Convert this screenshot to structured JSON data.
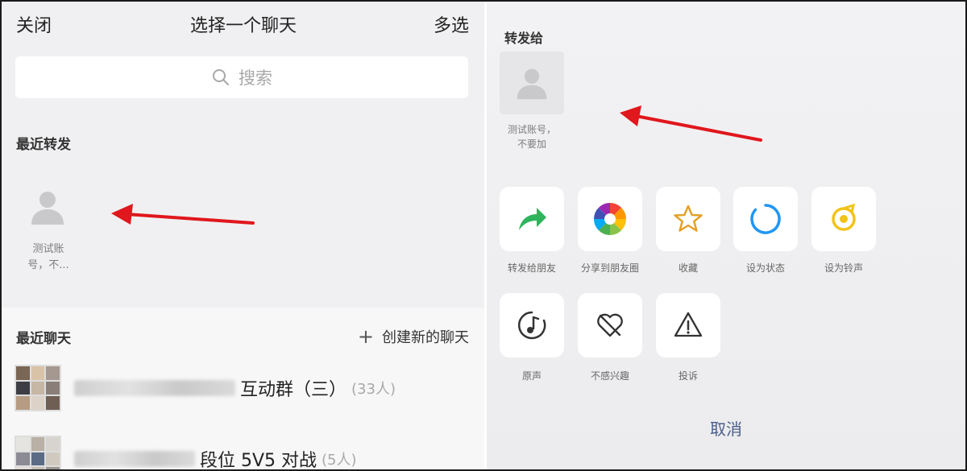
{
  "left": {
    "nav": {
      "close": "关闭",
      "title": "选择一个聊天",
      "multi_select": "多选"
    },
    "search": {
      "placeholder": "搜索"
    },
    "recent_forward": {
      "label": "最近转发",
      "contact": {
        "name_line1": "测试账",
        "name_line2": "号，不..."
      }
    },
    "recent_chats": {
      "label": "最近聊天",
      "create_new": "创建新的聊天",
      "items": [
        {
          "name": "互动群（三）",
          "count": "(33人)"
        },
        {
          "name": "段位 5V5 对战",
          "count": "(5人)"
        }
      ]
    }
  },
  "right": {
    "forward_to": {
      "label": "转发给",
      "contact": {
        "name_line1": "测试账号，",
        "name_line2": "不要加"
      }
    },
    "actions": [
      {
        "label": "转发给朋友",
        "icon": "forward-arrow-icon"
      },
      {
        "label": "分享到朋友圈",
        "icon": "moments-icon"
      },
      {
        "label": "收藏",
        "icon": "star-icon"
      },
      {
        "label": "设为状态",
        "icon": "status-icon"
      },
      {
        "label": "设为铃声",
        "icon": "ringtone-icon"
      },
      {
        "label": "原声",
        "icon": "music-note-icon"
      },
      {
        "label": "不感兴趣",
        "icon": "not-interested-icon"
      },
      {
        "label": "投诉",
        "icon": "warning-icon"
      }
    ],
    "cancel": "取消"
  },
  "colors": {
    "accent_green": "#2fb45c",
    "cancel_blue": "#4a5d8a",
    "arrow_red": "#e0171c"
  }
}
